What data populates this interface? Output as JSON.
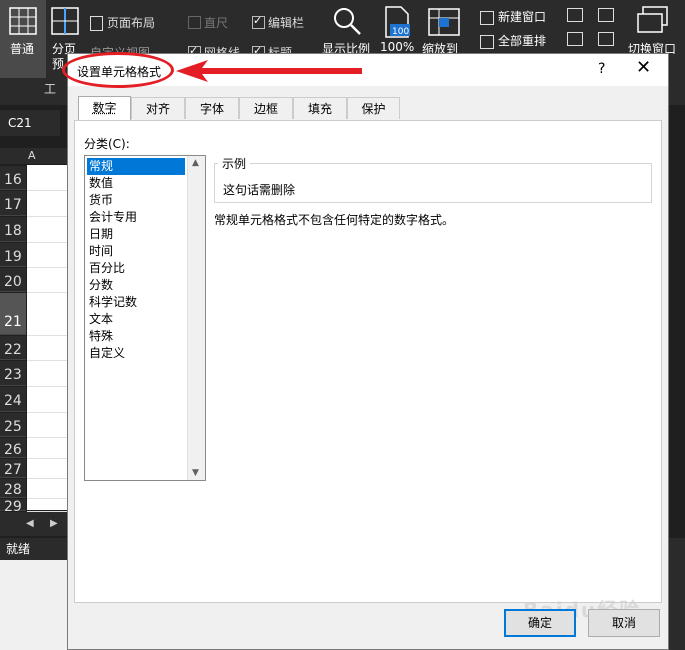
{
  "ribbon": {
    "normal": "普通",
    "page_break_1": "分页",
    "page_break_2": "预",
    "page_layout": "页面布局",
    "custom_view_fragment": "自定义视图",
    "ruler": "直尺",
    "formula_bar": "编辑栏",
    "gridlines": "网格线",
    "headings": "标题",
    "zoom": "显示比例",
    "zoom_100": "100%",
    "zoom_to_selection": "缩放到",
    "new_window": "新建窗口",
    "arrange_all": "全部重排",
    "switch_window": "切换窗口",
    "group_fragment": "工",
    "icon_100": "100"
  },
  "sheet": {
    "name_box": "C21",
    "col_a": "A",
    "rows": [
      "16",
      "17",
      "18",
      "19",
      "20",
      "21",
      "22",
      "23",
      "24",
      "25",
      "26",
      "27",
      "28",
      "29"
    ],
    "selected_row": "21",
    "status": "就绪"
  },
  "dialog": {
    "title": "设置单元格格式",
    "help": "?",
    "close": "✕",
    "tabs": [
      "数字",
      "对齐",
      "字体",
      "边框",
      "填充",
      "保护"
    ],
    "category_label": "分类(C):",
    "categories": [
      "常规",
      "数值",
      "货币",
      "会计专用",
      "日期",
      "时间",
      "百分比",
      "分数",
      "科学记数",
      "文本",
      "特殊",
      "自定义"
    ],
    "selected_category": "常规",
    "sample_legend": "示例",
    "sample_value": "这句话需删除",
    "description": "常规单元格格式不包含任何特定的数字格式。",
    "ok": "确定",
    "cancel": "取消"
  },
  "watermark": "Baidu经验",
  "colors": {
    "annotation": "#e31e24",
    "selection": "#0078d7",
    "ribbon_bg": "#2b2b2b"
  }
}
